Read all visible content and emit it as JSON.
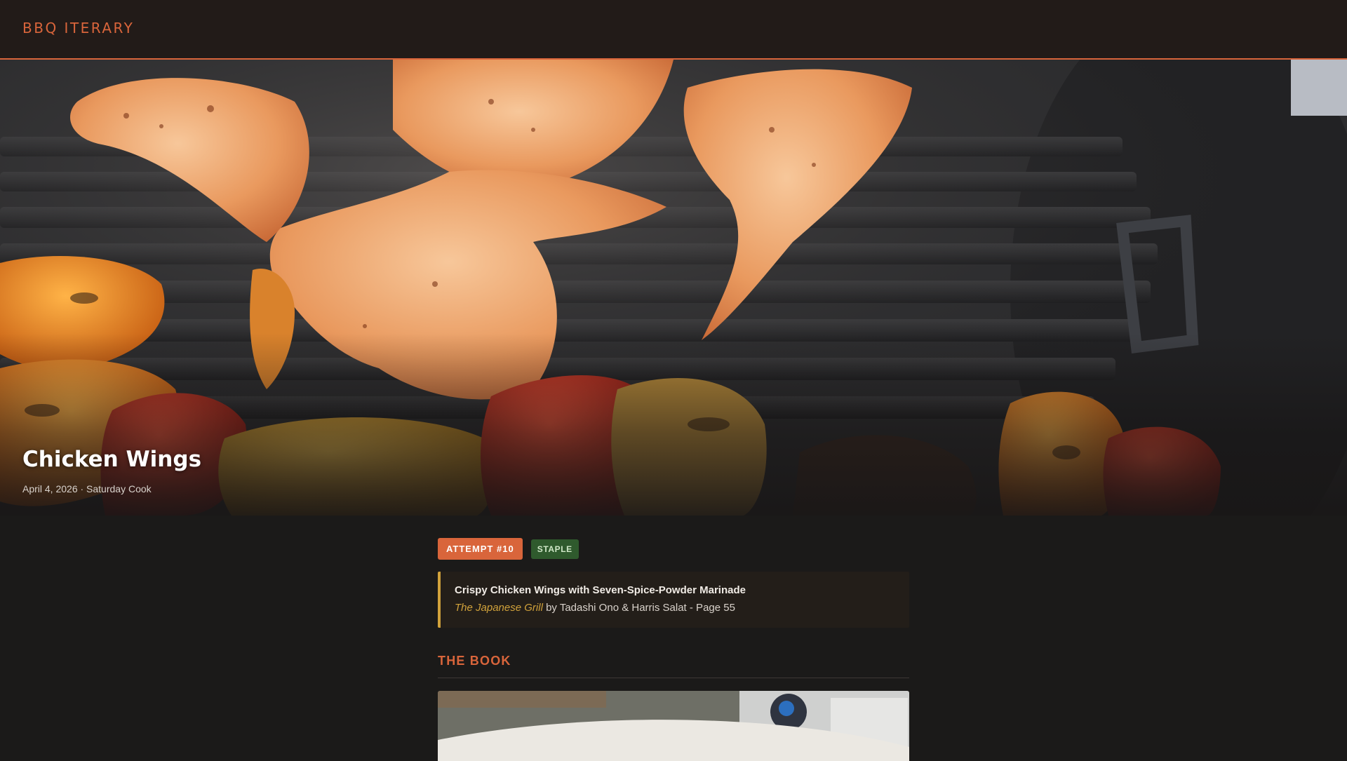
{
  "header": {
    "brand": "BBQ ITERARY"
  },
  "hero": {
    "image_name": "chicken-wings-on-grill-photo",
    "title": "Chicken Wings",
    "meta": "April 4, 2026 · Saturday Cook"
  },
  "badges": {
    "attempt": "ATTEMPT #10",
    "staple": "STAPLE"
  },
  "recipe": {
    "title": "Crispy Chicken Wings with Seven-Spice-Powder Marinade",
    "book": "The Japanese Grill",
    "by": " by Tadashi Ono & Harris Salat - Page 55"
  },
  "sections": {
    "book_heading": "THE BOOK"
  },
  "colors": {
    "accent": "#d9653b",
    "gold": "#d1a23b",
    "staple_green": "#2f5a2d",
    "background": "#1b1a19"
  }
}
